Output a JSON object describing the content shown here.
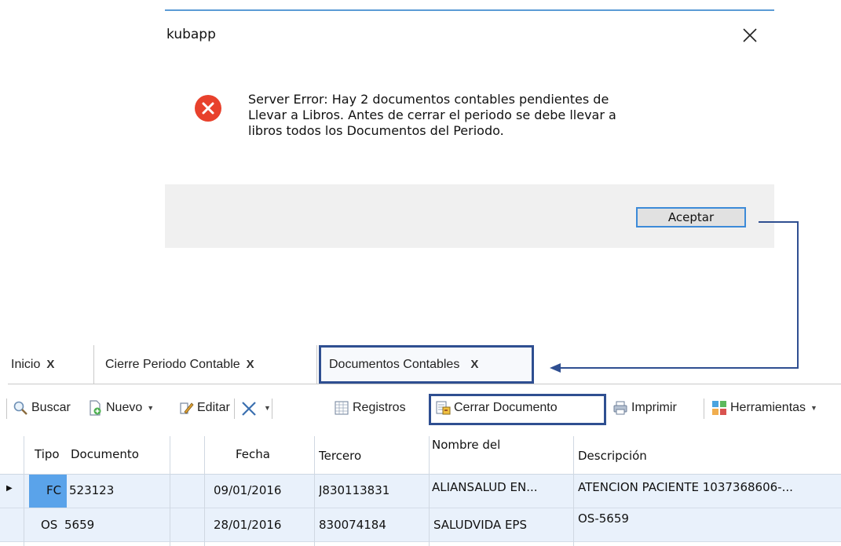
{
  "dialog": {
    "title": "kubapp",
    "close_label": "close",
    "message_lines": [
      "Server Error: Hay 2 documentos contables pendientes de",
      "Llevar a Libros. Antes de cerrar el periodo se debe llevar a",
      "libros todos los Documentos del Periodo."
    ],
    "accept_label": "Aceptar",
    "error_icon": "error-x-icon"
  },
  "tabs": [
    {
      "label": "Inicio",
      "close": "X"
    },
    {
      "label": "Cierre Periodo Contable",
      "close": "X"
    },
    {
      "label": "Documentos Contables",
      "close": "X",
      "active": true
    }
  ],
  "toolbar": {
    "buscar": "Buscar",
    "nuevo": "Nuevo",
    "editar": "Editar",
    "registros": "Registros",
    "cerrar_documento": "Cerrar Documento",
    "imprimir": "Imprimir",
    "herramientas": "Herramientas"
  },
  "grid": {
    "columns": [
      "Tipo",
      "Documento",
      "Fecha",
      "Tercero",
      "Nombre del",
      "Descripción"
    ],
    "rows": [
      {
        "tipo": "FC",
        "documento": "523123",
        "fecha": "09/01/2016",
        "tercero": "J830113831",
        "nombre": "ALIANSALUD EN...",
        "descripcion": "ATENCION PACIENTE 1037368606-..."
      },
      {
        "tipo": "OS",
        "documento": "5659",
        "fecha": "28/01/2016",
        "tercero": "830074184",
        "nombre": "SALUDVIDA  EPS",
        "descripcion": "OS-5659"
      }
    ]
  },
  "colors": {
    "accent_blue": "#2f4f91",
    "error_red": "#e8412c",
    "selected_cell": "#5aa3ea",
    "row_bg": "#e9f1fb"
  }
}
